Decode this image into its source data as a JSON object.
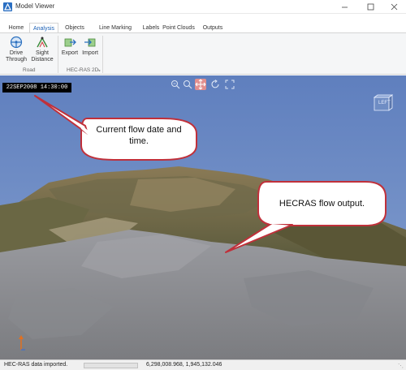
{
  "window": {
    "title": "Model Viewer",
    "minimize_icon": "minimize-icon",
    "maximize_icon": "maximize-icon",
    "close_icon": "close-icon"
  },
  "tabs": [
    {
      "label": "Home",
      "active": false
    },
    {
      "label": "Analysis",
      "active": true
    },
    {
      "label": "Objects",
      "active": false
    },
    {
      "label": "Line Marking",
      "active": false
    },
    {
      "label": "Labels",
      "active": false
    },
    {
      "label": "Point Clouds",
      "active": false
    },
    {
      "label": "Outputs",
      "active": false
    }
  ],
  "ribbon": {
    "road_group": {
      "label": "Road",
      "drive_through": {
        "line1": "Drive",
        "line2": "Through",
        "icon": "steering-wheel-icon"
      },
      "sight_distance": {
        "line1": "Sight",
        "line2": "Distance",
        "icon": "sight-distance-icon"
      }
    },
    "hecras_group": {
      "label": "HEC-RAS 2D",
      "export": {
        "label": "Export",
        "icon": "export-icon"
      },
      "import": {
        "label": "Import",
        "icon": "import-icon"
      }
    }
  },
  "viewport": {
    "datetime": "22SEP2008 14:30:00",
    "tools": [
      "zoom-out-icon",
      "zoom-in-icon",
      "pan-icon",
      "orbit-icon",
      "fullscreen-icon"
    ],
    "active_tool": "pan-icon",
    "viewcube_label": "LEFT",
    "callouts": {
      "flow_date_line1": "Current flow date and",
      "flow_date_line2": "time.",
      "hecras_output": "HECRAS flow output."
    }
  },
  "status": {
    "message": "HEC-RAS data imported.",
    "coordinates": "6,298,008.968, 1,945,132.046"
  },
  "colors": {
    "accent": "#1a5fb4",
    "callout_border": "#c0303a",
    "sky": "#6b89c2",
    "flow_surface": "#8d8e92"
  }
}
